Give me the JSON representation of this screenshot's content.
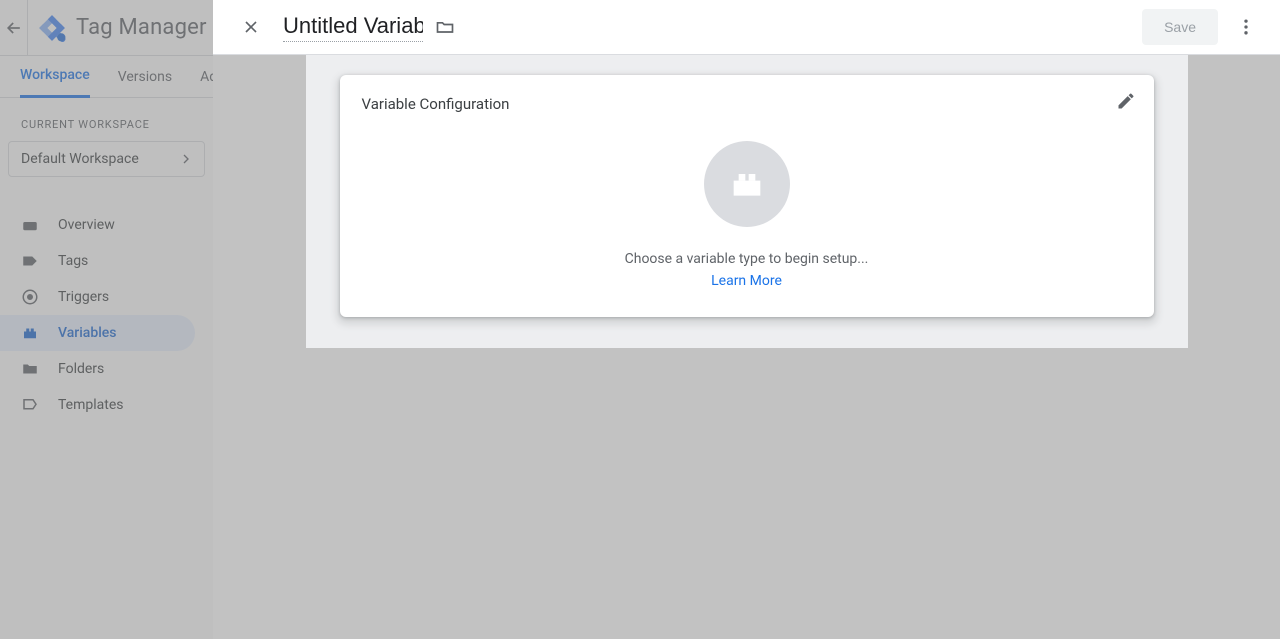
{
  "header": {
    "brand": "Tag Manager"
  },
  "tabs": {
    "workspace": "Workspace",
    "versions": "Versions",
    "admin": "Admin"
  },
  "sidebar": {
    "current_workspace_label": "CURRENT WORKSPACE",
    "workspace_name": "Default Workspace",
    "items": [
      {
        "label": "Overview"
      },
      {
        "label": "Tags"
      },
      {
        "label": "Triggers"
      },
      {
        "label": "Variables"
      },
      {
        "label": "Folders"
      },
      {
        "label": "Templates"
      }
    ]
  },
  "panel": {
    "title": "Untitled Variable",
    "save": "Save"
  },
  "card": {
    "title": "Variable Configuration",
    "empty_text": "Choose a variable type to begin setup...",
    "learn_more": "Learn More"
  }
}
